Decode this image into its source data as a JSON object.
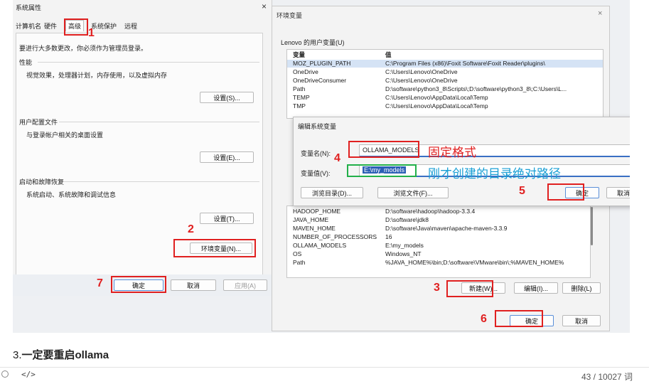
{
  "sysprop": {
    "title": "系统属性",
    "close": "×",
    "tabs": [
      "计算机名",
      "硬件",
      "高级",
      "系统保护",
      "远程"
    ],
    "admin_note": "要进行大多数更改，你必须作为管理员登录。",
    "perf_label": "性能",
    "perf_desc": "视觉效果，处理器计划，内存使用，以及虚拟内存",
    "settings_s": "设置(S)...",
    "profile_label": "用户配置文件",
    "profile_desc": "与登录帐户相关的桌面设置",
    "settings_e": "设置(E)...",
    "startup_label": "启动和故障恢复",
    "startup_desc": "系统启动、系统故障和调试信息",
    "settings_t": "设置(T)...",
    "env_button": "环境变量(N)...",
    "ok": "确定",
    "cancel": "取消",
    "apply": "应用(A)"
  },
  "env": {
    "title": "环境变量",
    "close": "×",
    "user_group": "Lenovo 的用户变量(U)",
    "col_var": "变量",
    "col_val": "值",
    "user_vars": [
      {
        "name": "MOZ_PLUGIN_PATH",
        "value": "C:\\Program Files (x86)\\Foxit Software\\Foxit Reader\\plugins\\"
      },
      {
        "name": "OneDrive",
        "value": "C:\\Users\\Lenovo\\OneDrive"
      },
      {
        "name": "OneDriveConsumer",
        "value": "C:\\Users\\Lenovo\\OneDrive"
      },
      {
        "name": "Path",
        "value": "D:\\software\\python3_8\\Scripts\\;D:\\software\\python3_8\\;C:\\Users\\L..."
      },
      {
        "name": "TEMP",
        "value": "C:\\Users\\Lenovo\\AppData\\Local\\Temp"
      },
      {
        "name": "TMP",
        "value": "C:\\Users\\Lenovo\\AppData\\Local\\Temp"
      }
    ],
    "sys_vars": [
      {
        "name": "HADOOP_HOME",
        "value": "D:\\software\\hadoop\\hadoop-3.3.4"
      },
      {
        "name": "JAVA_HOME",
        "value": "D:\\software\\jdk8"
      },
      {
        "name": "MAVEN_HOME",
        "value": "D:\\software\\Java\\maven\\apache-maven-3.3.9"
      },
      {
        "name": "NUMBER_OF_PROCESSORS",
        "value": "16"
      },
      {
        "name": "OLLAMA_MODELS",
        "value": "E:\\my_models"
      },
      {
        "name": "OS",
        "value": "Windows_NT"
      },
      {
        "name": "Path",
        "value": "%JAVA_HOME%\\bin;D:\\software\\VMware\\bin\\;%MAVEN_HOME%"
      }
    ],
    "new": "新建(W)...",
    "edit": "编辑(I)...",
    "delete": "删除(L)",
    "ok": "确定",
    "cancel": "取消"
  },
  "edit": {
    "title": "编辑系统变量",
    "name_label": "变量名(N):",
    "name_value": "OLLAMA_MODELS",
    "value_label": "变量值(V):",
    "value_value": "E:\\my_models",
    "browse_dir": "浏览目录(D)...",
    "browse_file": "浏览文件(F)...",
    "ok": "确定",
    "cancel": "取消"
  },
  "annotations": {
    "n1": "1",
    "n2": "2",
    "n3": "3",
    "n4": "4",
    "n5": "5",
    "n6": "6",
    "n7": "7",
    "fixed_format": "固定格式",
    "path_note": "刚才创建的目录绝对路径",
    "red": "#e02020",
    "cyan": "#1a9fd4"
  },
  "article": {
    "step_prefix": "3.",
    "step_text": "一定要重启ollama"
  },
  "bottombar": {
    "code_icon": "</>",
    "word_count": "43 / 10027 词"
  }
}
